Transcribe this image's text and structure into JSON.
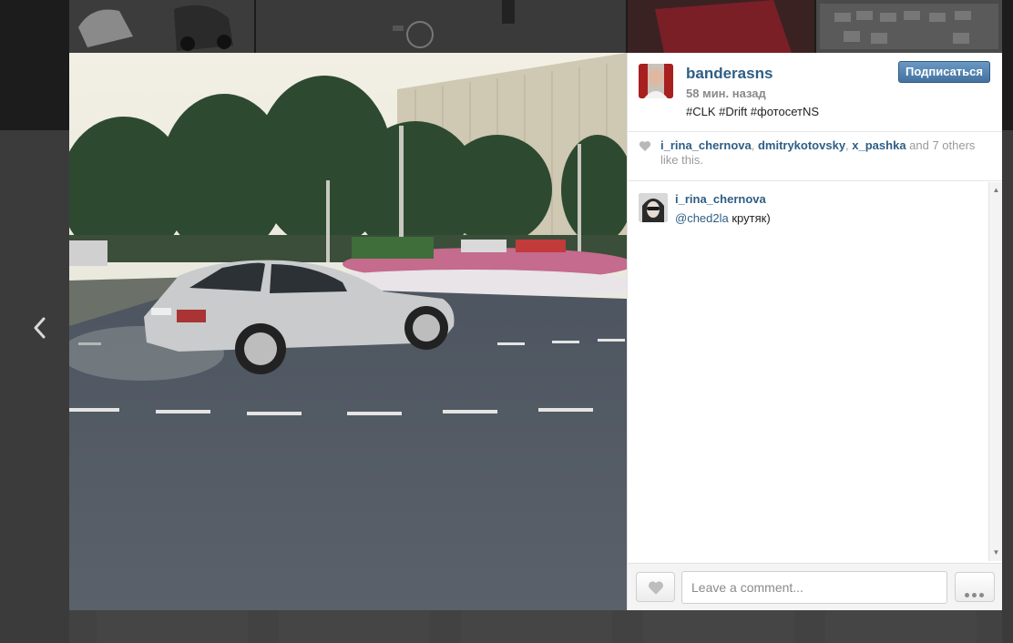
{
  "post": {
    "username": "banderasns",
    "time_ago": "58 мин. назад",
    "caption": "#CLK #Drift #фотосетNS",
    "follow_label": "Подписаться"
  },
  "likes": {
    "users": [
      "i_rina_chernova",
      "dmitrykotovsky",
      "x_pashka"
    ],
    "separator": ", ",
    "suffix": " and 7 others like this."
  },
  "comments": [
    {
      "user": "i_rina_chernova",
      "mention": "@ched2la",
      "text": " крутяк)"
    }
  ],
  "footer": {
    "comment_placeholder": "Leave a comment..."
  },
  "icons": {
    "prev": "chevron-left-icon",
    "like": "heart-icon",
    "more": "more-dots-icon"
  },
  "colors": {
    "link": "#2e5e86",
    "follow_button": "#4f7fae"
  }
}
